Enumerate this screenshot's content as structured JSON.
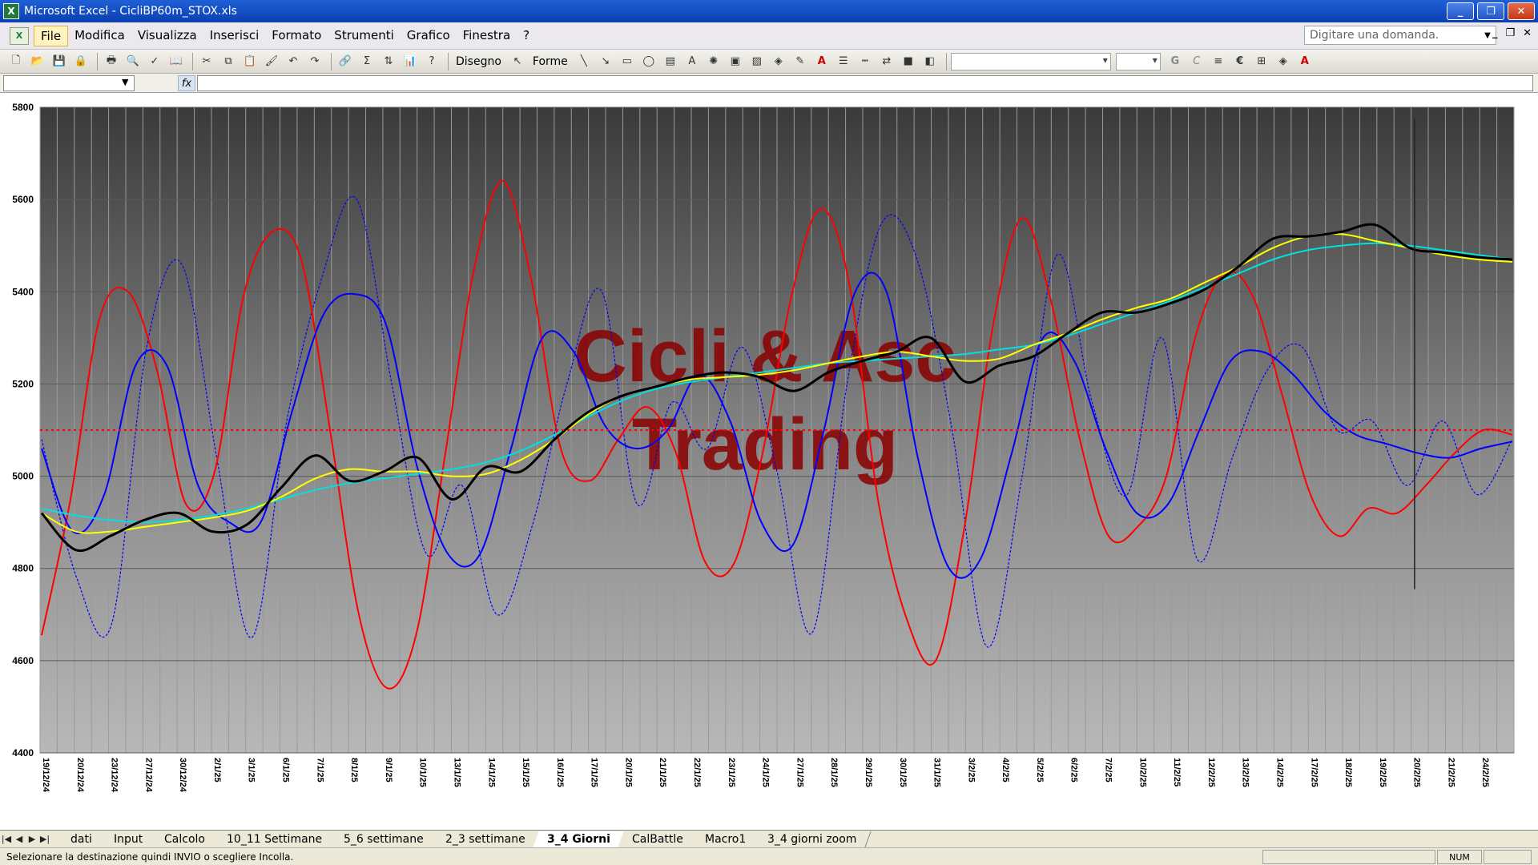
{
  "window": {
    "title": "Microsoft Excel - CicliBP60m_STOX.xls",
    "app_icon": "excel-icon",
    "controls": [
      "minimize-icon",
      "restore-icon",
      "close-icon"
    ]
  },
  "menu": {
    "items": [
      "File",
      "Modifica",
      "Visualizza",
      "Inserisci",
      "Formato",
      "Strumenti",
      "Grafico",
      "Finestra",
      "?"
    ],
    "active_item": "File",
    "help_placeholder": "Digitare una domanda."
  },
  "toolbar": {
    "draw_label": "Disegno",
    "shapes_label": "Forme",
    "font_bold": "G",
    "font_italic": "C",
    "euro": "€",
    "autosum": "Σ"
  },
  "formula_bar": {
    "fx_label": "fx",
    "name_box_value": "",
    "formula_value": ""
  },
  "chart_data": {
    "type": "line",
    "title": "",
    "watermark": [
      "Cicli & Asc",
      "Trading"
    ],
    "ylim": [
      4400,
      5800
    ],
    "y_ticks": [
      4400,
      4600,
      4800,
      5000,
      5200,
      5400,
      5600,
      5800
    ],
    "x_tick_labels": [
      "19/12/24",
      "20/12/24",
      "23/12/24",
      "27/12/24",
      "30/12/24",
      "2/1/25",
      "3/1/25",
      "6/1/25",
      "7/1/25",
      "8/1/25",
      "9/1/25",
      "10/1/25",
      "13/1/25",
      "14/1/25",
      "15/1/25",
      "16/1/25",
      "17/1/25",
      "20/1/25",
      "21/1/25",
      "22/1/25",
      "23/1/25",
      "24/1/25",
      "27/1/25",
      "28/1/25",
      "29/1/25",
      "30/1/25",
      "31/1/25",
      "3/2/25",
      "4/2/25",
      "5/2/25",
      "6/2/25",
      "7/2/25",
      "10/2/25",
      "11/2/25",
      "12/2/25",
      "13/2/25",
      "14/2/25",
      "17/2/25",
      "18/2/25",
      "19/2/25",
      "20/2/25",
      "21/2/25",
      "24/2/25"
    ],
    "reference_line": 5100,
    "vertical_marker": {
      "x_index": 40.1,
      "y_range": [
        4755,
        5775
      ]
    },
    "series": [
      {
        "color": "#000000",
        "style": "solid",
        "values": [
          4920,
          4840,
          4870,
          4905,
          4920,
          4880,
          4895,
          4975,
          5045,
          4990,
          5010,
          5040,
          4950,
          5020,
          5010,
          5080,
          5140,
          5175,
          5195,
          5215,
          5225,
          5215,
          5185,
          5225,
          5250,
          5270,
          5300,
          5205,
          5240,
          5260,
          5310,
          5355,
          5355,
          5375,
          5405,
          5455,
          5515,
          5520,
          5530,
          5545,
          5495,
          5485,
          5475,
          5470
        ]
      },
      {
        "color": "#ffff00",
        "style": "solid",
        "values": [
          4920,
          4880,
          4880,
          4890,
          4900,
          4910,
          4925,
          4955,
          4995,
          5015,
          5010,
          5010,
          5000,
          5005,
          5035,
          5080,
          5135,
          5175,
          5195,
          5210,
          5215,
          5220,
          5230,
          5245,
          5260,
          5270,
          5260,
          5250,
          5255,
          5285,
          5310,
          5340,
          5365,
          5385,
          5420,
          5455,
          5495,
          5520,
          5525,
          5510,
          5495,
          5480,
          5470,
          5465
        ]
      },
      {
        "color": "#00e0e0",
        "style": "solid",
        "values": [
          4930,
          4915,
          4905,
          4900,
          4905,
          4915,
          4930,
          4950,
          4970,
          4985,
          4995,
          5005,
          5015,
          5030,
          5055,
          5090,
          5130,
          5165,
          5190,
          5205,
          5215,
          5225,
          5235,
          5245,
          5250,
          5255,
          5260,
          5265,
          5275,
          5285,
          5305,
          5330,
          5355,
          5380,
          5410,
          5440,
          5470,
          5490,
          5500,
          5505,
          5500,
          5490,
          5480,
          5470
        ]
      },
      {
        "color": "#ff0000",
        "style": "solid",
        "values": [
          4655,
          4950,
          5340,
          5400,
          5230,
          4940,
          5010,
          5390,
          5530,
          5470,
          5100,
          4700,
          4540,
          4660,
          5050,
          5450,
          5640,
          5420,
          5060,
          4990,
          5080,
          5150,
          5050,
          4815,
          4810,
          5050,
          5390,
          5580,
          5420,
          4950,
          4690,
          4600,
          4890,
          5330,
          5560,
          5380,
          5080,
          4870,
          4890,
          5000,
          5300,
          5440,
          5390,
          5180,
          4960,
          4870,
          4930,
          4920,
          4980,
          5050,
          5100,
          5090
        ]
      },
      {
        "color": "#0000ff",
        "style": "solid",
        "values": [
          5060,
          4880,
          4960,
          5240,
          5240,
          4980,
          4900,
          4900,
          5140,
          5350,
          5395,
          5330,
          5020,
          4830,
          4830,
          5060,
          5300,
          5270,
          5110,
          5060,
          5100,
          5220,
          5120,
          4900,
          4850,
          5100,
          5400,
          5400,
          5040,
          4800,
          4820,
          5050,
          5300,
          5250,
          5060,
          4920,
          4940,
          5100,
          5250,
          5270,
          5220,
          5140,
          5090,
          5070,
          5050,
          5040,
          5060,
          5075
        ]
      },
      {
        "color": "#0000ff",
        "style": "dotted",
        "values": [
          5080,
          4780,
          4680,
          5280,
          5460,
          5040,
          4650,
          5120,
          5430,
          5600,
          5200,
          4830,
          4980,
          4700,
          4890,
          5200,
          5400,
          4940,
          5160,
          5060,
          5280,
          5010,
          4660,
          5200,
          5550,
          5470,
          5100,
          4630,
          5000,
          5480,
          5160,
          4960,
          5300,
          4820,
          5040,
          5230,
          5280,
          5100,
          5120,
          4980,
          5120,
          4960,
          5080
        ]
      }
    ]
  },
  "sheet_tabs": {
    "tabs": [
      "dati",
      "Input",
      "Calcolo",
      "10_11 Settimane",
      "5_6 settimane",
      "2_3 settimane",
      "3_4 Giorni",
      "CalBattle",
      "Macro1",
      "3_4 giorni zoom"
    ],
    "active": "3_4 Giorni"
  },
  "status": {
    "text": "Selezionare la destinazione quindi INVIO o scegliere Incolla.",
    "num": "NUM"
  }
}
